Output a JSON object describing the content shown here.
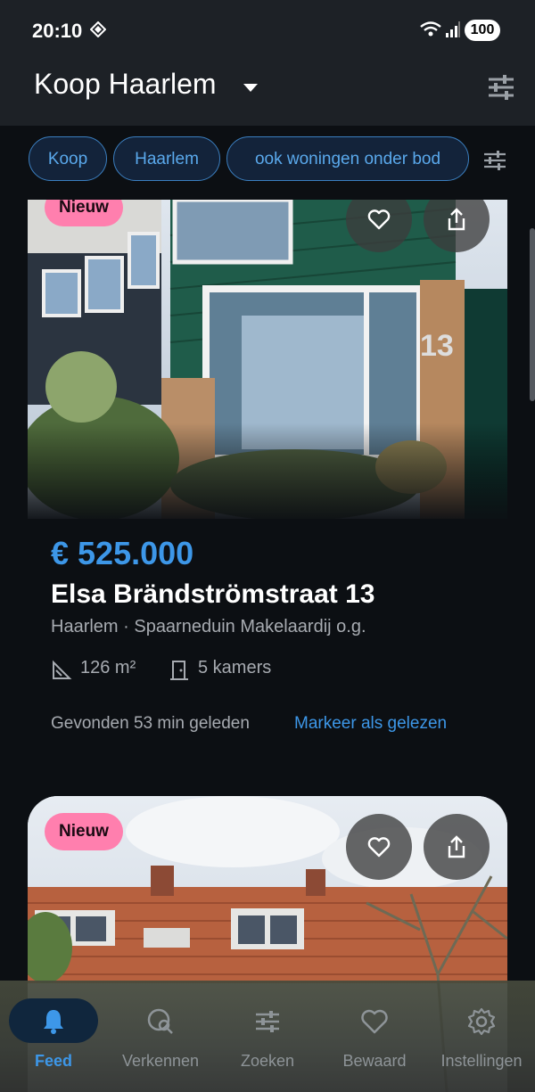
{
  "status": {
    "time": "20:10",
    "battery": "100"
  },
  "header": {
    "title": "Koop Haarlem"
  },
  "chips": [
    "Koop",
    "Haarlem",
    "ook woningen onder bod"
  ],
  "listings": [
    {
      "badge": "Nieuw",
      "price": "€ 525.000",
      "address": "Elsa Brändströmstraat 13",
      "subline": "Haarlem · Spaarneduin Makelaardij o.g.",
      "area": "126 m²",
      "rooms": "5 kamers",
      "found": "Gevonden 53 min geleden",
      "mark_read": "Markeer als gelezen"
    },
    {
      "badge": "Nieuw"
    }
  ],
  "nav": {
    "items": [
      {
        "label": "Feed",
        "active": true
      },
      {
        "label": "Verkennen"
      },
      {
        "label": "Zoeken"
      },
      {
        "label": "Bewaard"
      },
      {
        "label": "Instellingen"
      }
    ]
  },
  "colors": {
    "accent": "#3d97e8",
    "badge": "#ff7fae",
    "chip_border": "#3b7fc0"
  }
}
